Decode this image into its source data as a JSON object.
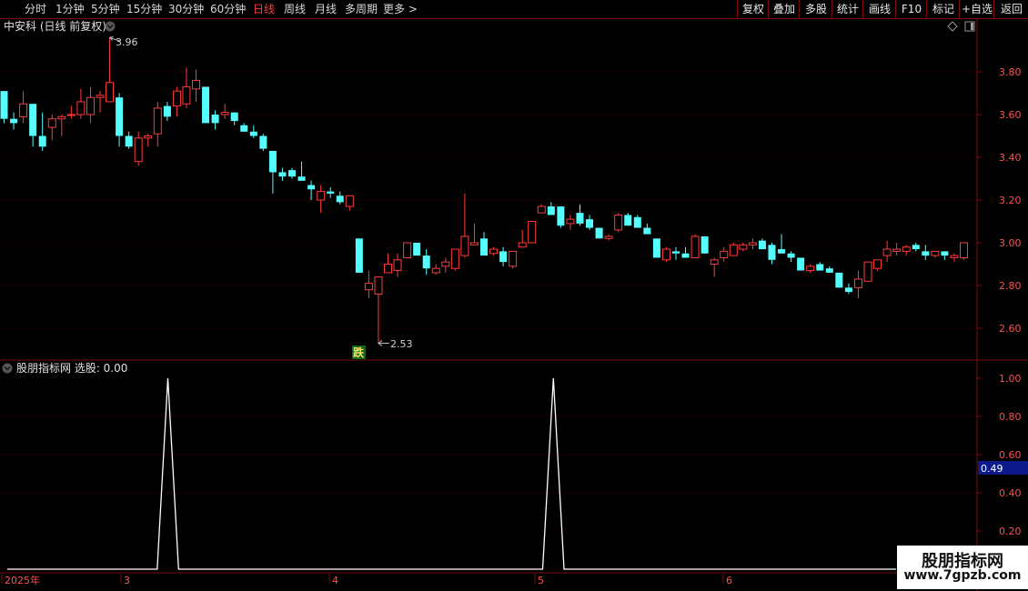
{
  "toolbar": {
    "timeframes": [
      "分时",
      "1分钟",
      "5分钟",
      "15分钟",
      "30分钟",
      "60分钟",
      "日线",
      "周线",
      "月线",
      "多周期",
      "更多 >"
    ],
    "active": "日线",
    "right_buttons": [
      "复权",
      "叠加",
      "多股",
      "统计",
      "画线",
      "F10",
      "标记",
      "+自选",
      "返回"
    ]
  },
  "main_panel": {
    "title": "中安科 (日线 前复权)",
    "high_label": "3.96",
    "low_label": "2.53",
    "signal_badge": "跌"
  },
  "indicator_panel": {
    "title": "股朋指标网 选股: 0.00",
    "cursor_value": "0.49"
  },
  "time_axis": [
    "2025年",
    "3",
    "4",
    "5",
    "6"
  ],
  "watermark": {
    "title": "股朋指标网",
    "url": "www.7gpzb.com"
  },
  "colors": {
    "up": "#ff3b3b",
    "down": "#54ffff",
    "axis": "#7a0c0c",
    "bg": "#000000"
  },
  "chart_data": [
    {
      "type": "candlestick",
      "title": "中安科 (日线 前复权)",
      "y_ticks": [
        "3.80",
        "3.60",
        "3.40",
        "3.20",
        "3.00",
        "2.80",
        "2.60"
      ],
      "ylim": [
        2.47,
        4.12
      ],
      "annotations": [
        {
          "text": "3.96",
          "type": "high"
        },
        {
          "text": "2.53",
          "type": "low"
        },
        {
          "text": "跌",
          "type": "signal"
        }
      ],
      "candles": [
        [
          3.71,
          3.71,
          3.56,
          3.58
        ],
        [
          3.58,
          3.61,
          3.53,
          3.56
        ],
        [
          3.59,
          3.71,
          3.56,
          3.65
        ],
        [
          3.65,
          3.65,
          3.45,
          3.5
        ],
        [
          3.5,
          3.61,
          3.43,
          3.45
        ],
        [
          3.54,
          3.6,
          3.48,
          3.58
        ],
        [
          3.58,
          3.6,
          3.5,
          3.59
        ],
        [
          3.6,
          3.64,
          3.58,
          3.6
        ],
        [
          3.6,
          3.72,
          3.58,
          3.66
        ],
        [
          3.6,
          3.73,
          3.56,
          3.68
        ],
        [
          3.68,
          3.71,
          3.61,
          3.69
        ],
        [
          3.66,
          3.96,
          3.66,
          3.75
        ],
        [
          3.68,
          3.7,
          3.45,
          3.5
        ],
        [
          3.5,
          3.52,
          3.44,
          3.45
        ],
        [
          3.38,
          3.52,
          3.36,
          3.49
        ],
        [
          3.49,
          3.51,
          3.45,
          3.5
        ],
        [
          3.51,
          3.66,
          3.45,
          3.63
        ],
        [
          3.64,
          3.66,
          3.57,
          3.59
        ],
        [
          3.64,
          3.73,
          3.59,
          3.71
        ],
        [
          3.65,
          3.82,
          3.63,
          3.73
        ],
        [
          3.72,
          3.81,
          3.66,
          3.76
        ],
        [
          3.73,
          3.73,
          3.56,
          3.56
        ],
        [
          3.6,
          3.62,
          3.53,
          3.56
        ],
        [
          3.6,
          3.65,
          3.58,
          3.61
        ],
        [
          3.61,
          3.61,
          3.55,
          3.57
        ],
        [
          3.55,
          3.56,
          3.52,
          3.52
        ],
        [
          3.52,
          3.55,
          3.49,
          3.5
        ],
        [
          3.5,
          3.51,
          3.43,
          3.44
        ],
        [
          3.43,
          3.43,
          3.23,
          3.33
        ],
        [
          3.33,
          3.35,
          3.29,
          3.31
        ],
        [
          3.34,
          3.35,
          3.3,
          3.31
        ],
        [
          3.31,
          3.38,
          3.3,
          3.29
        ],
        [
          3.27,
          3.29,
          3.2,
          3.25
        ],
        [
          3.2,
          3.27,
          3.14,
          3.24
        ],
        [
          3.24,
          3.26,
          3.21,
          3.23
        ],
        [
          3.22,
          3.24,
          3.18,
          3.19
        ],
        [
          3.17,
          3.22,
          3.15,
          3.22
        ],
        [
          3.02,
          3.02,
          2.86,
          2.86
        ],
        [
          2.78,
          2.87,
          2.74,
          2.81
        ],
        [
          2.76,
          2.84,
          2.53,
          2.84
        ],
        [
          2.86,
          2.95,
          2.86,
          2.9
        ],
        [
          2.87,
          2.95,
          2.84,
          2.92
        ],
        [
          2.93,
          3.0,
          2.93,
          3.0
        ],
        [
          3.0,
          3.0,
          2.94,
          2.94
        ],
        [
          2.94,
          2.97,
          2.85,
          2.88
        ],
        [
          2.86,
          2.9,
          2.85,
          2.88
        ],
        [
          2.89,
          2.93,
          2.86,
          2.91
        ],
        [
          2.88,
          2.97,
          2.87,
          2.97
        ],
        [
          2.94,
          3.23,
          2.93,
          3.03
        ],
        [
          2.99,
          3.09,
          2.99,
          3.0
        ],
        [
          3.02,
          3.05,
          2.94,
          2.94
        ],
        [
          2.95,
          2.98,
          2.94,
          2.97
        ],
        [
          2.96,
          2.98,
          2.89,
          2.91
        ],
        [
          2.89,
          2.95,
          2.88,
          2.96
        ],
        [
          2.98,
          3.06,
          2.98,
          3.0
        ],
        [
          3.0,
          3.1,
          3.0,
          3.1
        ],
        [
          3.14,
          3.18,
          3.14,
          3.17
        ],
        [
          3.17,
          3.19,
          3.13,
          3.13
        ],
        [
          3.17,
          3.17,
          3.07,
          3.08
        ],
        [
          3.09,
          3.13,
          3.06,
          3.11
        ],
        [
          3.14,
          3.18,
          3.08,
          3.09
        ],
        [
          3.11,
          3.13,
          3.06,
          3.07
        ],
        [
          3.07,
          3.07,
          3.02,
          3.02
        ],
        [
          3.02,
          3.04,
          3.01,
          3.03
        ],
        [
          3.06,
          3.14,
          3.05,
          3.13
        ],
        [
          3.13,
          3.14,
          3.08,
          3.08
        ],
        [
          3.12,
          3.13,
          3.09,
          3.07
        ],
        [
          3.07,
          3.09,
          3.04,
          3.04
        ],
        [
          3.02,
          3.02,
          2.93,
          2.93
        ],
        [
          2.92,
          2.98,
          2.91,
          2.97
        ],
        [
          2.96,
          2.98,
          2.92,
          2.95
        ],
        [
          2.95,
          2.98,
          2.93,
          2.93
        ],
        [
          2.93,
          3.04,
          2.93,
          3.03
        ],
        [
          3.03,
          3.03,
          2.95,
          2.95
        ],
        [
          2.9,
          2.93,
          2.84,
          2.92
        ],
        [
          2.93,
          2.98,
          2.91,
          2.96
        ],
        [
          2.94,
          3.0,
          2.94,
          2.99
        ],
        [
          2.97,
          3.0,
          2.96,
          2.99
        ],
        [
          2.99,
          3.02,
          2.97,
          3.0
        ],
        [
          3.01,
          3.02,
          2.97,
          2.97
        ],
        [
          2.99,
          3.0,
          2.9,
          2.92
        ],
        [
          2.97,
          3.04,
          2.95,
          2.95
        ],
        [
          2.95,
          2.96,
          2.91,
          2.93
        ],
        [
          2.93,
          2.93,
          2.87,
          2.87
        ],
        [
          2.87,
          2.9,
          2.86,
          2.89
        ],
        [
          2.9,
          2.91,
          2.87,
          2.87
        ],
        [
          2.88,
          2.89,
          2.86,
          2.86
        ],
        [
          2.86,
          2.86,
          2.79,
          2.79
        ],
        [
          2.79,
          2.81,
          2.76,
          2.77
        ],
        [
          2.79,
          2.87,
          2.74,
          2.83
        ],
        [
          2.82,
          2.91,
          2.82,
          2.91
        ],
        [
          2.88,
          2.92,
          2.87,
          2.92
        ],
        [
          2.94,
          3.01,
          2.91,
          2.97
        ],
        [
          2.96,
          3.0,
          2.94,
          2.97
        ],
        [
          2.96,
          2.99,
          2.94,
          2.98
        ],
        [
          2.99,
          3.0,
          2.96,
          2.97
        ],
        [
          2.96,
          2.99,
          2.92,
          2.94
        ],
        [
          2.94,
          2.96,
          2.93,
          2.96
        ],
        [
          2.96,
          2.96,
          2.92,
          2.94
        ],
        [
          2.93,
          2.95,
          2.91,
          2.94
        ],
        [
          2.93,
          3.0,
          2.92,
          3.0
        ]
      ]
    },
    {
      "type": "line",
      "title": "股朋指标网 选股",
      "y_ticks": [
        "1.00",
        "0.80",
        "0.60",
        "0.40",
        "0.20"
      ],
      "ylim": [
        -0.05,
        1.07
      ],
      "baseline": 0,
      "spikes": [
        {
          "index": 15,
          "value": 1.0
        },
        {
          "index": 51,
          "value": 1.0
        }
      ],
      "length": 84
    }
  ]
}
